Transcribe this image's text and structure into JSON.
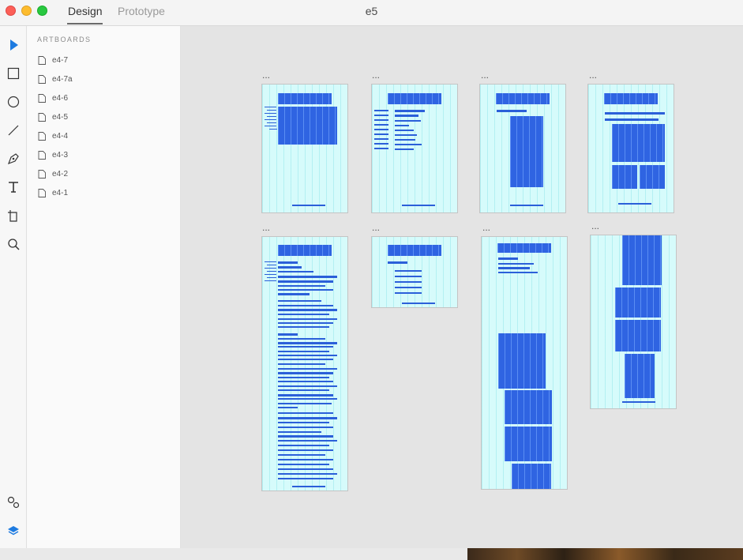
{
  "window": {
    "tabs": [
      {
        "label": "Design",
        "active": true
      },
      {
        "label": "Prototype",
        "active": false
      }
    ],
    "document_title": "e5"
  },
  "toolbar": {
    "tools": [
      "select-tool-icon",
      "rectangle-tool-icon",
      "ellipse-tool-icon",
      "line-tool-icon",
      "pen-tool-icon",
      "text-tool-icon",
      "artboard-tool-icon",
      "zoom-tool-icon"
    ],
    "bottom_tools": [
      "symbols-icon",
      "layers-icon"
    ],
    "accent_color": "#1e7be0"
  },
  "panel": {
    "heading": "ARTBOARDS",
    "items": [
      {
        "label": "e4-7"
      },
      {
        "label": "e4-7a"
      },
      {
        "label": "e4-6"
      },
      {
        "label": "e4-5"
      },
      {
        "label": "e4-4"
      },
      {
        "label": "e4-3"
      },
      {
        "label": "e4-2"
      },
      {
        "label": "e4-1"
      }
    ]
  },
  "canvas": {
    "artboard_label": "...",
    "artboard_count": 8,
    "colors": {
      "artboard_fill": "#d6fbfb",
      "block_fill": "#2f64e2",
      "canvas_bg": "#e4e4e4"
    }
  }
}
